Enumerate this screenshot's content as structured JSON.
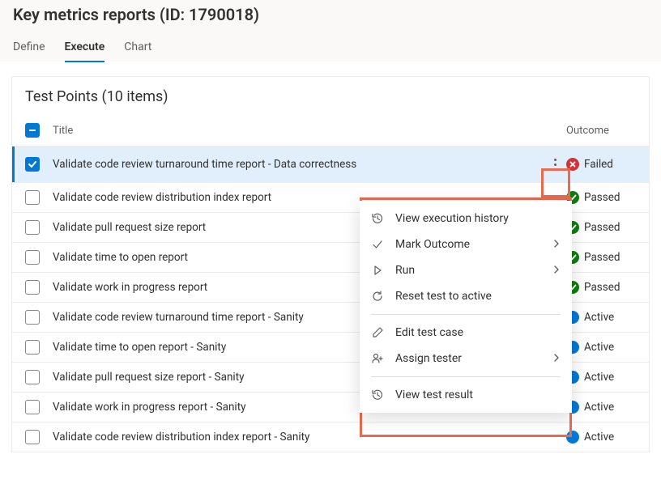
{
  "header": {
    "title": "Key metrics reports (ID: 1790018)",
    "tabs": [
      {
        "label": "Define",
        "active": false
      },
      {
        "label": "Execute",
        "active": true
      },
      {
        "label": "Chart",
        "active": false
      }
    ]
  },
  "panel": {
    "title": "Test Points (10 items)",
    "columns": {
      "title": "Title",
      "outcome": "Outcome"
    }
  },
  "rows": [
    {
      "selected": true,
      "title": "Validate code review turnaround time report - Data correctness",
      "outcome": "Failed",
      "outcome_kind": "fail",
      "show_more": true
    },
    {
      "selected": false,
      "title": "Validate code review distribution index report",
      "outcome": "Passed",
      "outcome_kind": "pass",
      "show_more": false
    },
    {
      "selected": false,
      "title": "Validate pull request size report",
      "outcome": "Passed",
      "outcome_kind": "pass",
      "show_more": false
    },
    {
      "selected": false,
      "title": "Validate time to open report",
      "outcome": "Passed",
      "outcome_kind": "pass",
      "show_more": false
    },
    {
      "selected": false,
      "title": "Validate work in progress report",
      "outcome": "Passed",
      "outcome_kind": "pass",
      "show_more": false
    },
    {
      "selected": false,
      "title": "Validate code review turnaround time report - Sanity",
      "outcome": "Active",
      "outcome_kind": "active",
      "show_more": false
    },
    {
      "selected": false,
      "title": "Validate time to open report - Sanity",
      "outcome": "Active",
      "outcome_kind": "active",
      "show_more": false
    },
    {
      "selected": false,
      "title": "Validate pull request size report - Sanity",
      "outcome": "Active",
      "outcome_kind": "active",
      "show_more": false
    },
    {
      "selected": false,
      "title": "Validate work in progress report - Sanity",
      "outcome": "Active",
      "outcome_kind": "active",
      "show_more": false
    },
    {
      "selected": false,
      "title": "Validate code review distribution index report - Sanity",
      "outcome": "Active",
      "outcome_kind": "active",
      "show_more": false
    }
  ],
  "context_menu": {
    "groups": [
      [
        {
          "icon": "history-icon",
          "label": "View execution history",
          "submenu": false
        },
        {
          "icon": "check-icon",
          "label": "Mark Outcome",
          "submenu": true
        },
        {
          "icon": "play-icon",
          "label": "Run",
          "submenu": true
        },
        {
          "icon": "reset-icon",
          "label": "Reset test to active",
          "submenu": false
        }
      ],
      [
        {
          "icon": "pencil-icon",
          "label": "Edit test case",
          "submenu": false
        },
        {
          "icon": "person-icon",
          "label": "Assign tester",
          "submenu": true
        }
      ],
      [
        {
          "icon": "history-icon",
          "label": "View test result",
          "submenu": false
        }
      ]
    ]
  },
  "colors": {
    "accent": "#0078d4",
    "pass": "#107c10",
    "fail": "#d13438",
    "highlight": "#e86a4f"
  }
}
